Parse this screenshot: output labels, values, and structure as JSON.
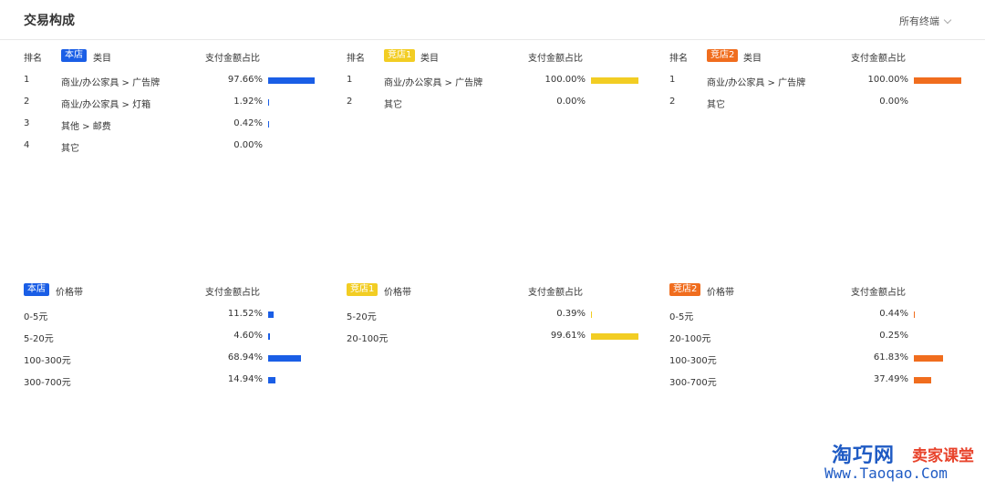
{
  "header": {
    "title": "交易构成",
    "terminal": "所有终端"
  },
  "colors": {
    "self": "#1a5ee6",
    "competitor1": "#f2cd23",
    "competitor2": "#f06d1e"
  },
  "category": {
    "rank_label": "排名",
    "cat_label": "类目",
    "ratio_label": "支付金额占比",
    "panels": [
      {
        "tag": "本店",
        "color": "#1a5ee6",
        "rows": [
          {
            "rank": "1",
            "name": "商业/办公家具 > 广告牌",
            "pct": "97.66%",
            "value": 97.66
          },
          {
            "rank": "2",
            "name": "商业/办公家具 > 灯箱",
            "pct": "1.92%",
            "value": 1.92
          },
          {
            "rank": "3",
            "name": "其他 > 邮费",
            "pct": "0.42%",
            "value": 0.42
          },
          {
            "rank": "4",
            "name": "其它",
            "pct": "0.00%",
            "value": 0
          }
        ]
      },
      {
        "tag": "竞店1",
        "color": "#f2cd23",
        "rows": [
          {
            "rank": "1",
            "name": "商业/办公家具 > 广告牌",
            "pct": "100.00%",
            "value": 100
          },
          {
            "rank": "2",
            "name": "其它",
            "pct": "0.00%",
            "value": 0
          }
        ]
      },
      {
        "tag": "竞店2",
        "color": "#f06d1e",
        "rows": [
          {
            "rank": "1",
            "name": "商业/办公家具 > 广告牌",
            "pct": "100.00%",
            "value": 100
          },
          {
            "rank": "2",
            "name": "其它",
            "pct": "0.00%",
            "value": 0
          }
        ]
      }
    ]
  },
  "price": {
    "band_label": "价格带",
    "ratio_label": "支付金额占比",
    "panels": [
      {
        "tag": "本店",
        "color": "#1a5ee6",
        "rows": [
          {
            "name": "0-5元",
            "pct": "11.52%",
            "value": 11.52
          },
          {
            "name": "5-20元",
            "pct": "4.60%",
            "value": 4.6
          },
          {
            "name": "100-300元",
            "pct": "68.94%",
            "value": 68.94
          },
          {
            "name": "300-700元",
            "pct": "14.94%",
            "value": 14.94
          }
        ]
      },
      {
        "tag": "竞店1",
        "color": "#f2cd23",
        "rows": [
          {
            "name": "5-20元",
            "pct": "0.39%",
            "value": 0.39
          },
          {
            "name": "20-100元",
            "pct": "99.61%",
            "value": 99.61
          }
        ]
      },
      {
        "tag": "竞店2",
        "color": "#f06d1e",
        "rows": [
          {
            "name": "0-5元",
            "pct": "0.44%",
            "value": 0.44
          },
          {
            "name": "20-100元",
            "pct": "0.25%",
            "value": 0.25
          },
          {
            "name": "100-300元",
            "pct": "61.83%",
            "value": 61.83
          },
          {
            "name": "300-700元",
            "pct": "37.49%",
            "value": 37.49
          }
        ]
      }
    ]
  },
  "watermark": {
    "brand": "淘巧网",
    "sub": "卖家课堂",
    "url": "Www.Taoqao.Com"
  }
}
